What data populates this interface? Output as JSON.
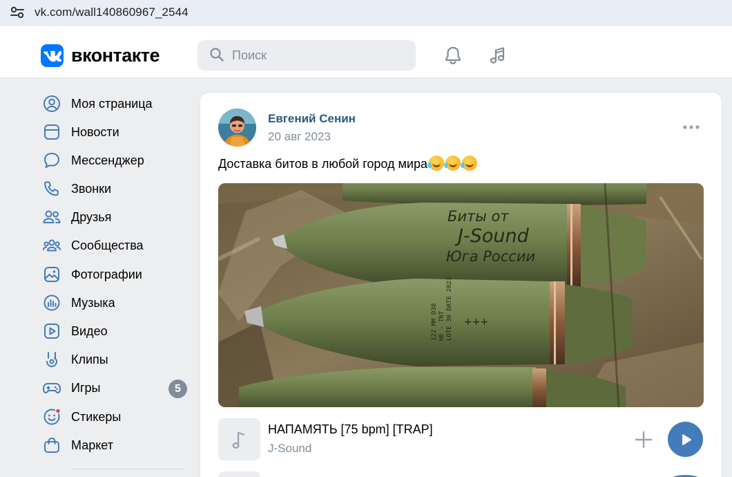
{
  "browser": {
    "url": "vk.com/wall140860967_2544"
  },
  "header": {
    "brand": "вконтакте",
    "search_placeholder": "Поиск",
    "icons": [
      "bell-icon",
      "music-icon"
    ]
  },
  "sidebar": {
    "items": [
      {
        "label": "Моя страница",
        "icon": "user-circle-icon"
      },
      {
        "label": "Новости",
        "icon": "news-icon"
      },
      {
        "label": "Мессенджер",
        "icon": "message-icon"
      },
      {
        "label": "Звонки",
        "icon": "phone-icon"
      },
      {
        "label": "Друзья",
        "icon": "friends-icon"
      },
      {
        "label": "Сообщества",
        "icon": "communities-icon"
      },
      {
        "label": "Фотографии",
        "icon": "photo-icon"
      },
      {
        "label": "Музыка",
        "icon": "music-chart-icon"
      },
      {
        "label": "Видео",
        "icon": "video-icon"
      },
      {
        "label": "Клипы",
        "icon": "clips-icon"
      },
      {
        "label": "Игры",
        "icon": "gamepad-icon",
        "badge": "5"
      },
      {
        "label": "Стикеры",
        "icon": "sticker-icon"
      },
      {
        "label": "Маркет",
        "icon": "market-bag-icon"
      }
    ]
  },
  "post": {
    "author": "Евгений Сенин",
    "date": "20 авг 2023",
    "text": "Доставка битов в любой город мира",
    "emoji_count": 3,
    "photo_inscription": {
      "line1": "Биты от",
      "line2": "J-Sound",
      "line3": "Юга России"
    },
    "audio": {
      "title": "НАПАМЯТЬ [75 bpm] [TRAP]",
      "artist": "J-Sound"
    }
  },
  "colors": {
    "vk_blue": "#0077ff",
    "link": "#2a5885",
    "secondary_text": "#818c99",
    "play_button": "#447bba",
    "page_bg": "#edeef0"
  }
}
